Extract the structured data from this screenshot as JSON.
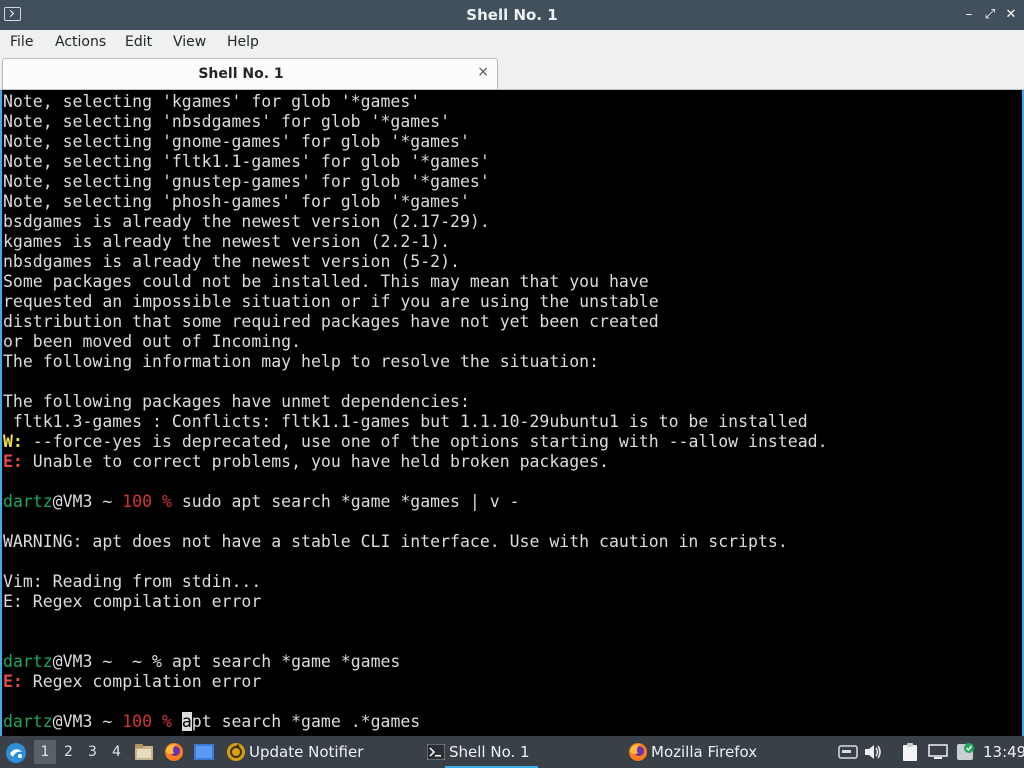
{
  "window": {
    "title": "Shell No. 1",
    "controls": {
      "minimize": "–",
      "restore": "⤢",
      "close": "✕"
    }
  },
  "menu": [
    "File",
    "Actions",
    "Edit",
    "View",
    "Help"
  ],
  "tab": {
    "label": "Shell No. 1",
    "close": "×"
  },
  "terminal": {
    "lines": [
      "Note, selecting 'kgames' for glob '*games'",
      "Note, selecting 'nbsdgames' for glob '*games'",
      "Note, selecting 'gnome-games' for glob '*games'",
      "Note, selecting 'fltk1.1-games' for glob '*games'",
      "Note, selecting 'gnustep-games' for glob '*games'",
      "Note, selecting 'phosh-games' for glob '*games'",
      "bsdgames is already the newest version (2.17-29).",
      "kgames is already the newest version (2.2-1).",
      "nbsdgames is already the newest version (5-2).",
      "Some packages could not be installed. This may mean that you have",
      "requested an impossible situation or if you are using the unstable",
      "distribution that some required packages have not yet been created",
      "or been moved out of Incoming.",
      "The following information may help to resolve the situation:",
      "",
      "The following packages have unmet dependencies:",
      " fltk1.3-games : Conflicts: fltk1.1-games but 1.1.10-29ubuntu1 is to be installed"
    ],
    "warn_prefix": "W:",
    "warn_text": " --force-yes is deprecated, use one of the options starting with --allow instead.",
    "err_prefix": "E:",
    "err_text": " Unable to correct problems, you have held broken packages.",
    "prompt_user": "dartz",
    "prompt_host": "@VM3 ~ ",
    "prompt_status": "100 %",
    "prompt_sep": " ~ % ",
    "cmd1": " sudo apt search *game *games | v -",
    "apt_warning": "WARNING: apt does not have a stable CLI interface. Use with caution in scripts.",
    "vim_reading": "Vim: Reading from stdin...",
    "vim_error": "E: Regex compilation error",
    "cmd2": "apt search *game *games",
    "err2_text": " Regex compilation error",
    "cursor_char": "a",
    "cmd3_rest": "pt search *game .*games"
  },
  "taskbar": {
    "workspaces": [
      "1",
      "2",
      "3",
      "4"
    ],
    "tasks": [
      {
        "label": "Update Notifier"
      },
      {
        "label": "Shell No. 1"
      },
      {
        "label": "Mozilla Firefox"
      }
    ],
    "clock": "13:49"
  },
  "colors": {
    "accent": "#3daee9",
    "prompt_user": "#1fa75d",
    "prompt_status": "#d23434",
    "warn": "#f1e05a",
    "error": "#ea4a4a"
  }
}
